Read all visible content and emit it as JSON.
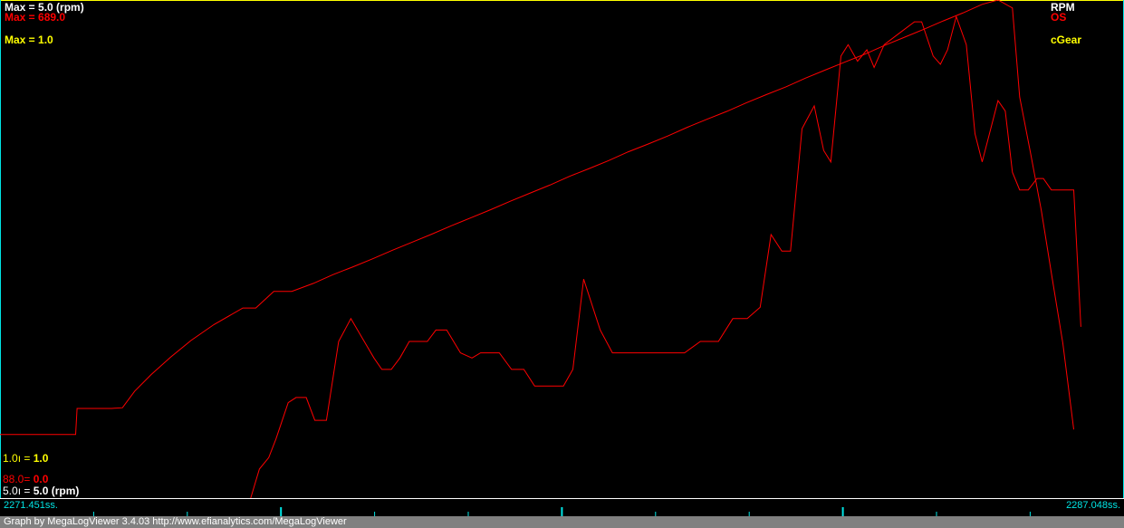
{
  "colors": {
    "rpm": "#ff0000",
    "os": "#ff0000",
    "cgear": "#ffff00",
    "axis_cyan": "#00e5e5",
    "white": "#ffffff",
    "background": "#000000"
  },
  "legend": {
    "max_rpm": "Max = 5.0 (rpm)",
    "max_os": "Max = 689.0",
    "max_cgear": "Max = 1.0",
    "name_rpm": "RPM",
    "name_os": "OS",
    "name_cgear": "cGear",
    "min_cgear_prefix": "1.0",
    "min_cgear_value": "1.0",
    "min_os_prefix": "88.0",
    "min_os_value": "0.0",
    "min_rpm_prefix": "5.0",
    "min_rpm_value": "5.0 (rpm)"
  },
  "time_axis": {
    "start": "2271.451ss.",
    "end": "2287.048ss."
  },
  "footer": {
    "text": "Graph by MegaLogViewer 3.4.03 http://www.efianalytics.com/MegaLogViewer"
  },
  "chart_data": {
    "type": "line",
    "x_unit": "s",
    "x_range": [
      2271.451,
      2287.048
    ],
    "series": [
      {
        "name": "OS",
        "max": 689.0,
        "min": 0.0,
        "points": [
          [
            2271.45,
            88
          ],
          [
            2272.5,
            88
          ],
          [
            2272.52,
            124
          ],
          [
            2273.0,
            124
          ],
          [
            2273.15,
            125
          ],
          [
            2273.32,
            148
          ],
          [
            2273.55,
            171
          ],
          [
            2273.82,
            195
          ],
          [
            2274.1,
            218
          ],
          [
            2274.42,
            240
          ],
          [
            2274.82,
            263
          ],
          [
            2275.0,
            263
          ],
          [
            2275.25,
            286
          ],
          [
            2275.5,
            286
          ],
          [
            2275.8,
            297
          ],
          [
            2276.07,
            309
          ],
          [
            2276.35,
            320
          ],
          [
            2276.62,
            331
          ],
          [
            2276.9,
            343
          ],
          [
            2277.17,
            354
          ],
          [
            2277.44,
            365
          ],
          [
            2277.72,
            377
          ],
          [
            2277.99,
            388
          ],
          [
            2278.26,
            399
          ],
          [
            2278.54,
            411
          ],
          [
            2278.81,
            422
          ],
          [
            2279.08,
            433
          ],
          [
            2279.35,
            445
          ],
          [
            2279.63,
            456
          ],
          [
            2279.9,
            467
          ],
          [
            2280.17,
            479
          ],
          [
            2280.45,
            490
          ],
          [
            2280.72,
            501
          ],
          [
            2280.99,
            513
          ],
          [
            2281.26,
            524
          ],
          [
            2281.54,
            535
          ],
          [
            2281.81,
            547
          ],
          [
            2282.08,
            558
          ],
          [
            2282.36,
            569
          ],
          [
            2282.63,
            581
          ],
          [
            2282.9,
            592
          ],
          [
            2283.17,
            603
          ],
          [
            2283.45,
            614
          ],
          [
            2283.72,
            626
          ],
          [
            2283.99,
            637
          ],
          [
            2284.26,
            648
          ],
          [
            2284.54,
            660
          ],
          [
            2284.81,
            671
          ],
          [
            2285.08,
            683
          ],
          [
            2285.3,
            689
          ],
          [
            2285.5,
            678
          ],
          [
            2285.6,
            555
          ],
          [
            2285.75,
            478
          ],
          [
            2285.9,
            398
          ],
          [
            2286.05,
            305
          ],
          [
            2286.2,
            214
          ],
          [
            2286.35,
            95
          ]
        ]
      },
      {
        "name": "RPM",
        "unit": "rpm",
        "max": 5.0,
        "min": 5.0,
        "points": [
          [
            2274.93,
            0
          ],
          [
            2275.05,
            28
          ],
          [
            2275.18,
            39
          ],
          [
            2275.28,
            57
          ],
          [
            2275.45,
            92
          ],
          [
            2275.56,
            97
          ],
          [
            2275.7,
            97
          ],
          [
            2275.82,
            75
          ],
          [
            2275.98,
            75
          ],
          [
            2276.15,
            151
          ],
          [
            2276.32,
            173
          ],
          [
            2276.48,
            154
          ],
          [
            2276.64,
            135
          ],
          [
            2276.75,
            124
          ],
          [
            2276.88,
            124
          ],
          [
            2277.0,
            135
          ],
          [
            2277.13,
            151
          ],
          [
            2277.25,
            151
          ],
          [
            2277.38,
            151
          ],
          [
            2277.5,
            162
          ],
          [
            2277.65,
            162
          ],
          [
            2277.84,
            140
          ],
          [
            2278.0,
            135
          ],
          [
            2278.12,
            140
          ],
          [
            2278.38,
            140
          ],
          [
            2278.55,
            124
          ],
          [
            2278.72,
            124
          ],
          [
            2278.87,
            108
          ],
          [
            2279.05,
            108
          ],
          [
            2279.27,
            108
          ],
          [
            2279.4,
            124
          ],
          [
            2279.55,
            211
          ],
          [
            2279.78,
            162
          ],
          [
            2279.95,
            140
          ],
          [
            2280.5,
            140
          ],
          [
            2280.95,
            140
          ],
          [
            2281.17,
            151
          ],
          [
            2281.42,
            151
          ],
          [
            2281.62,
            173
          ],
          [
            2281.82,
            173
          ],
          [
            2282.0,
            184
          ],
          [
            2282.15,
            254
          ],
          [
            2282.3,
            238
          ],
          [
            2282.42,
            238
          ],
          [
            2282.58,
            356
          ],
          [
            2282.75,
            378
          ],
          [
            2282.88,
            335
          ],
          [
            2282.98,
            324
          ],
          [
            2283.12,
            426
          ],
          [
            2283.22,
            437
          ],
          [
            2283.35,
            421
          ],
          [
            2283.48,
            432
          ],
          [
            2283.58,
            415
          ],
          [
            2283.72,
            437
          ],
          [
            2283.93,
            448
          ],
          [
            2284.14,
            459
          ],
          [
            2284.24,
            459
          ],
          [
            2284.4,
            426
          ],
          [
            2284.5,
            418
          ],
          [
            2284.6,
            432
          ],
          [
            2284.72,
            464
          ],
          [
            2284.86,
            437
          ],
          [
            2284.98,
            351
          ],
          [
            2285.08,
            324
          ],
          [
            2285.3,
            383
          ],
          [
            2285.4,
            373
          ],
          [
            2285.5,
            314
          ],
          [
            2285.6,
            297
          ],
          [
            2285.72,
            297
          ],
          [
            2285.84,
            308
          ],
          [
            2285.93,
            308
          ],
          [
            2286.04,
            297
          ],
          [
            2286.35,
            297
          ],
          [
            2286.45,
            165
          ]
        ]
      },
      {
        "name": "cGear",
        "max": 1.0,
        "min": 1.0,
        "points": []
      }
    ]
  }
}
